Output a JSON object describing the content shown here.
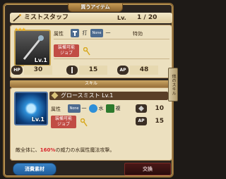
{
  "window": {
    "title": "買うアイテム"
  },
  "item": {
    "name": "ミストスタッフ",
    "level_label": "Lv.",
    "level_value": "1 / 20",
    "icon_level": "Lv.1",
    "stars": "★★★",
    "attribute_label": "属性",
    "attack_type": "打",
    "element_tag": "None",
    "element_value": "一",
    "special_label": "特効",
    "job_label": "装備可能\nジョブ",
    "stats": {
      "hp_label": "HP",
      "hp": "30",
      "atk": "15",
      "ap_label": "AP",
      "ap": "48"
    }
  },
  "skill": {
    "section_label": "スキル",
    "name": "グロースミスト Lv.1",
    "icon_level": "Lv.1",
    "attribute_label": "属性",
    "none_tag": "None",
    "none_value": "一",
    "element": "水",
    "target": "複",
    "job_label": "装備可能\nジョブ",
    "stat1_value": "10",
    "ap_label": "AP",
    "stat2_value": "15",
    "description_prefix": "敵全体に、",
    "description_highlight": "160%",
    "description_suffix": "の威力の水属性魔法攻撃。"
  },
  "buttons": {
    "materials": "消費素材",
    "exchange": "交換"
  },
  "side_tab": "他のスキル",
  "colors": {
    "accent_gold": "#c9a35e",
    "skill_blue": "#2e8fd8",
    "red_highlight": "#d8262d"
  }
}
